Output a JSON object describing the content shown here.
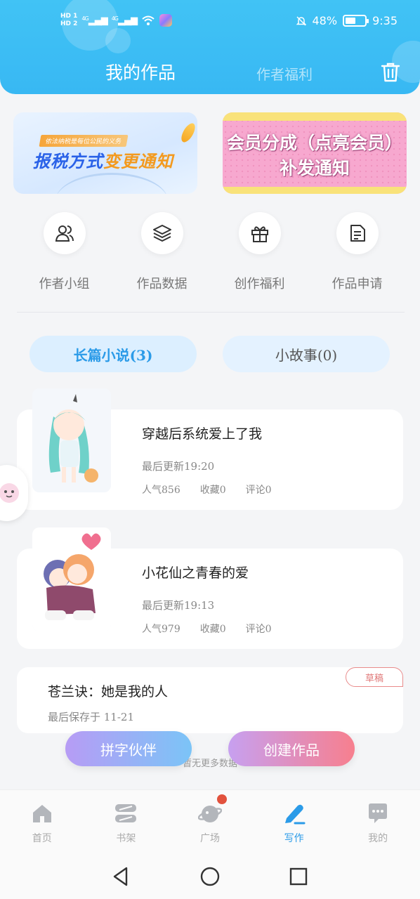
{
  "status_bar": {
    "hd1": "HD 1",
    "hd2": "HD 2",
    "net1": "4G",
    "net2": "4G",
    "battery": "48%",
    "battery_level": 0.48,
    "time": "9:35"
  },
  "header": {
    "tab_active": "我的作品",
    "tab_inactive": "作者福利",
    "trash_icon": "trash-icon",
    "accent_color": "#3ebdf4"
  },
  "banners": [
    {
      "tag": "依法纳税是每位公民的义务",
      "title_blue": "报税方式",
      "title_orange": "变更通知"
    },
    {
      "title": "会员分成（点亮会员）补发通知"
    }
  ],
  "quick_actions": [
    {
      "label": "作者小组",
      "icon": "people-icon"
    },
    {
      "label": "作品数据",
      "icon": "layers-icon"
    },
    {
      "label": "创作福利",
      "icon": "gift-icon"
    },
    {
      "label": "作品申请",
      "icon": "document-icon"
    }
  ],
  "categories": {
    "long": "长篇小说(3)",
    "short": "小故事(0)"
  },
  "works": [
    {
      "title": "穿越后系统爱上了我",
      "updated": "最后更新19:20",
      "popularity": "人气856",
      "favorites": "收藏0",
      "comments": "评论0"
    },
    {
      "title": "小花仙之青春的爱",
      "updated": "最后更新19:13",
      "popularity": "人气979",
      "favorites": "收藏0",
      "comments": "评论0"
    }
  ],
  "draft": {
    "title": "苍兰诀：她是我的人",
    "saved": "最后保存于 11-21",
    "badge": "草稿"
  },
  "no_more_text": "暂无更多数据",
  "buttons": {
    "team": "拼字伙伴",
    "create": "创建作品"
  },
  "bottom_nav": [
    {
      "label": "首页",
      "icon": "home-icon"
    },
    {
      "label": "书架",
      "icon": "bookshelf-icon"
    },
    {
      "label": "广场",
      "icon": "planet-icon"
    },
    {
      "label": "写作",
      "icon": "pen-icon",
      "active": true
    },
    {
      "label": "我的",
      "icon": "chat-icon"
    }
  ]
}
